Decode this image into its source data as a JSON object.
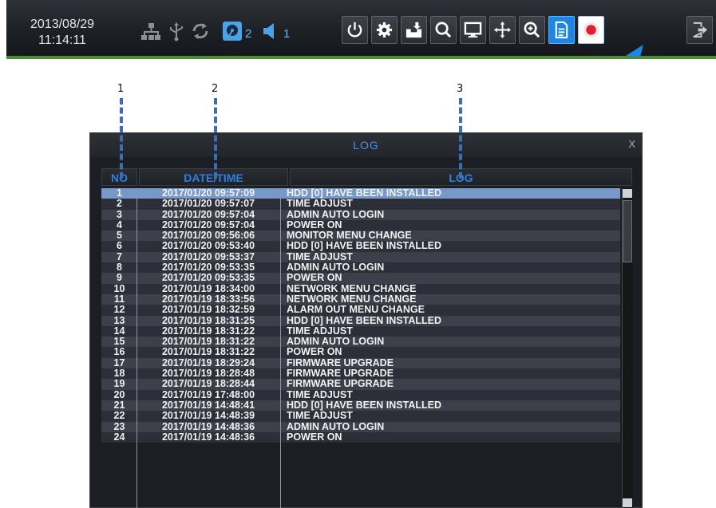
{
  "toolbar": {
    "date": "2013/08/29",
    "time": "11:14:11",
    "status": {
      "hdd_count": "2",
      "audio_count": "1",
      "icons": [
        "network-icon",
        "usb-icon",
        "sync-icon",
        "hdd-icon",
        "speaker-icon"
      ]
    },
    "buttons": [
      "power",
      "settings",
      "backup",
      "search",
      "display",
      "ptz",
      "zoom",
      "log",
      "record",
      "exit"
    ],
    "active_button": "log",
    "accent_color": "#1b86e6"
  },
  "callouts": [
    "1",
    "2",
    "3"
  ],
  "log": {
    "title": "LOG",
    "close_label": "X",
    "columns": {
      "no": "NO",
      "datetime": "DATE/TIME",
      "log": "LOG"
    },
    "selected_row": 1,
    "rows": [
      {
        "no": "1",
        "datetime": "2017/01/20 09:57:09",
        "log": "HDD [0] HAVE BEEN INSTALLED"
      },
      {
        "no": "2",
        "datetime": "2017/01/20 09:57:07",
        "log": "TIME ADJUST"
      },
      {
        "no": "3",
        "datetime": "2017/01/20 09:57:04",
        "log": "ADMIN AUTO LOGIN"
      },
      {
        "no": "4",
        "datetime": "2017/01/20 09:57:04",
        "log": "POWER ON"
      },
      {
        "no": "5",
        "datetime": "2017/01/20 09:56:06",
        "log": "MONITOR MENU CHANGE"
      },
      {
        "no": "6",
        "datetime": "2017/01/20 09:53:40",
        "log": "HDD [0] HAVE BEEN INSTALLED"
      },
      {
        "no": "7",
        "datetime": "2017/01/20 09:53:37",
        "log": "TIME ADJUST"
      },
      {
        "no": "8",
        "datetime": "2017/01/20 09:53:35",
        "log": "ADMIN AUTO LOGIN"
      },
      {
        "no": "9",
        "datetime": "2017/01/20 09:53:35",
        "log": "POWER ON"
      },
      {
        "no": "10",
        "datetime": "2017/01/19 18:34:00",
        "log": "NETWORK MENU CHANGE"
      },
      {
        "no": "11",
        "datetime": "2017/01/19 18:33:56",
        "log": "NETWORK MENU CHANGE"
      },
      {
        "no": "12",
        "datetime": "2017/01/19 18:32:59",
        "log": "ALARM OUT MENU CHANGE"
      },
      {
        "no": "13",
        "datetime": "2017/01/19 18:31:25",
        "log": "HDD [0] HAVE BEEN INSTALLED"
      },
      {
        "no": "14",
        "datetime": "2017/01/19 18:31:22",
        "log": "TIME ADJUST"
      },
      {
        "no": "15",
        "datetime": "2017/01/19 18:31:22",
        "log": "ADMIN AUTO LOGIN"
      },
      {
        "no": "16",
        "datetime": "2017/01/19 18:31:22",
        "log": "POWER ON"
      },
      {
        "no": "17",
        "datetime": "2017/01/19 18:29:24",
        "log": "FIRMWARE UPGRADE"
      },
      {
        "no": "18",
        "datetime": "2017/01/19 18:28:48",
        "log": "FIRMWARE UPGRADE"
      },
      {
        "no": "19",
        "datetime": "2017/01/19 18:28:44",
        "log": "FIRMWARE UPGRADE"
      },
      {
        "no": "20",
        "datetime": "2017/01/19 17:48:00",
        "log": "TIME ADJUST"
      },
      {
        "no": "21",
        "datetime": "2017/01/19 14:48:41",
        "log": "HDD [0] HAVE BEEN INSTALLED"
      },
      {
        "no": "22",
        "datetime": "2017/01/19 14:48:39",
        "log": "TIME ADJUST"
      },
      {
        "no": "23",
        "datetime": "2017/01/19 14:48:36",
        "log": "ADMIN AUTO LOGIN"
      },
      {
        "no": "24",
        "datetime": "2017/01/19 14:48:36",
        "log": "POWER ON"
      }
    ]
  }
}
